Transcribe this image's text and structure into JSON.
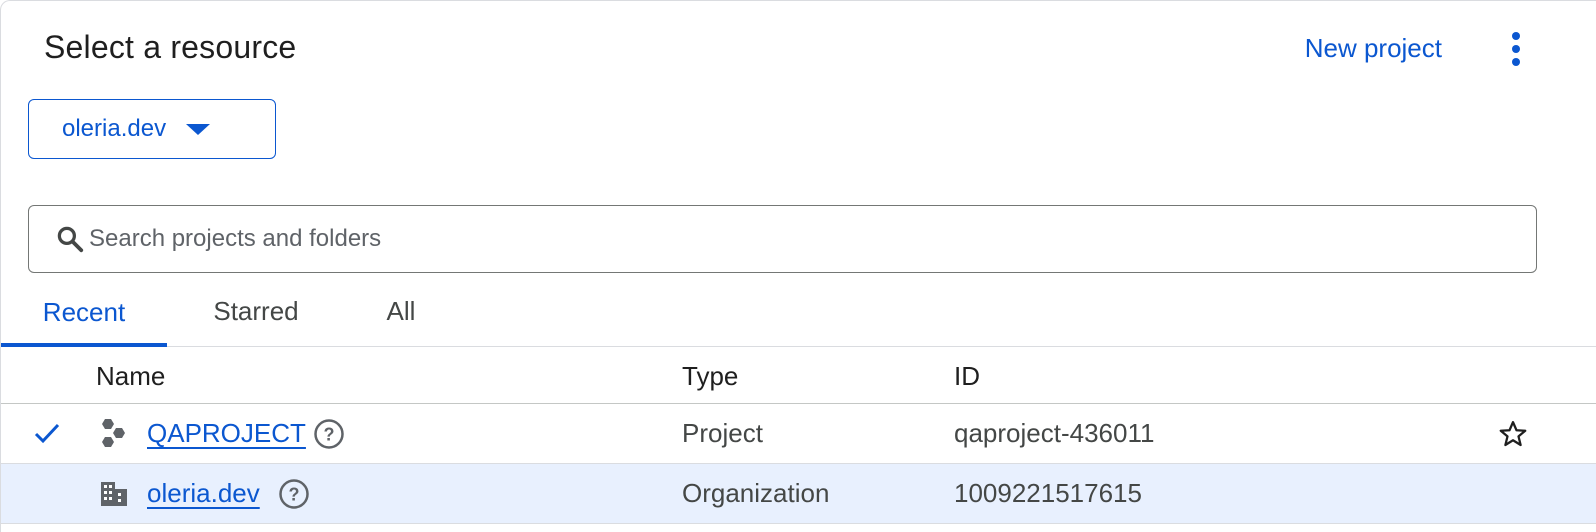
{
  "dialog": {
    "title": "Select a resource",
    "new_project_label": "New project",
    "more_icon": "more-vert-icon"
  },
  "org_selector": {
    "value": "oleria.dev",
    "icon": "arrow-drop-down-icon"
  },
  "search": {
    "placeholder": "Search projects and folders",
    "value": "",
    "icon": "search-icon"
  },
  "tabs": [
    {
      "label": "Recent",
      "active": true
    },
    {
      "label": "Starred",
      "active": false
    },
    {
      "label": "All",
      "active": false
    }
  ],
  "table": {
    "columns": [
      "Name",
      "Type",
      "ID"
    ],
    "rows": [
      {
        "selected": true,
        "icon": "project-hexagons-icon",
        "name": "QAPROJECT",
        "type": "Project",
        "id": "qaproject-436011",
        "starred": false
      },
      {
        "selected": false,
        "icon": "organization-building-icon",
        "name": "oleria.dev",
        "type": "Organization",
        "id": "1009221517615",
        "starred": false
      }
    ]
  },
  "colors": {
    "accent": "#0b57d0",
    "highlight_row": "#e8f0fe",
    "text_primary": "#1f1f1f",
    "text_secondary": "#444746"
  }
}
